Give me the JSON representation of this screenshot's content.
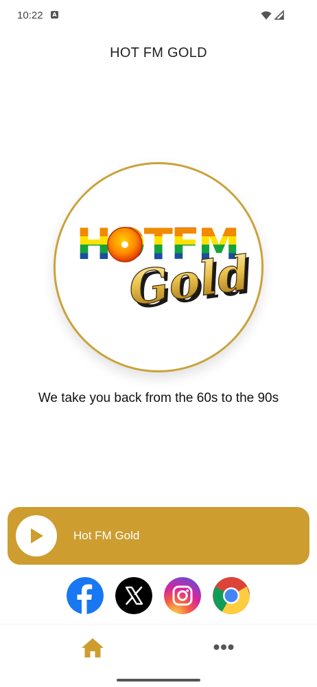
{
  "status_bar": {
    "time": "10:22",
    "badge": "A",
    "icons": [
      "wifi-icon",
      "signal-icon"
    ]
  },
  "app": {
    "title": "HOT FM GOLD",
    "accent_color": "#cd9d2f",
    "logo_border_color": "#c9a23a"
  },
  "logo": {
    "line1": "HOTFM",
    "line2": "Gold"
  },
  "tagline": "We take you back from the 60s to the 90s",
  "player": {
    "station_name": "Hot FM Gold",
    "play_icon": "play-icon"
  },
  "socials": [
    {
      "name": "facebook",
      "color": "#1877f2"
    },
    {
      "name": "x",
      "color": "#000000"
    },
    {
      "name": "instagram",
      "color": "#d6249f"
    },
    {
      "name": "chrome",
      "color": "#4285f4"
    }
  ],
  "bottom_nav": {
    "items": [
      {
        "name": "home",
        "icon": "home-icon",
        "active": true
      },
      {
        "name": "more",
        "icon": "more-icon",
        "active": false
      }
    ]
  }
}
